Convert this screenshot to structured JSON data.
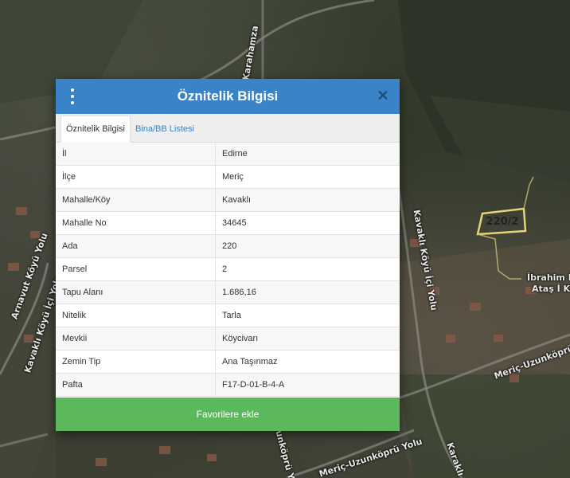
{
  "map": {
    "labels": {
      "karahamza": "Karahamza",
      "arnavut": "Arnavut Köyü Yolu",
      "kavakli_left": "Kavaklı Köyü İçi Yolu",
      "kavakli_mid": "Kavaklı Köyü İçi Yolu",
      "ibrahim": "İbrahim Hi",
      "atas": "Ataş İ K",
      "meric_uzunkopru_right": "Meriç-Uzunköprü",
      "meric_uzunkopru_bottom": "Meriç-Uzunköprü Yolu",
      "uzunkopru_yolu": "Uzunköprü Yolu",
      "karakli": "Karaklı"
    },
    "parcel_label": "220/2",
    "parcel_color": "#e6d37a"
  },
  "dialog": {
    "title": "Öznitelik Bilgisi",
    "close_symbol": "✕",
    "header_color": "#3a83c6",
    "tabs": [
      {
        "label": "Öznitelik Bilgisi",
        "active": true
      },
      {
        "label": "Bina/BB Listesi",
        "active": false
      }
    ],
    "rows": [
      {
        "key": "İl",
        "value": "Edirne"
      },
      {
        "key": "İlçe",
        "value": "Meriç"
      },
      {
        "key": "Mahalle/Köy",
        "value": "Kavaklı"
      },
      {
        "key": "Mahalle No",
        "value": "34645"
      },
      {
        "key": "Ada",
        "value": "220"
      },
      {
        "key": "Parsel",
        "value": "2"
      },
      {
        "key": "Tapu Alanı",
        "value": "1.686,16"
      },
      {
        "key": "Nitelik",
        "value": "Tarla"
      },
      {
        "key": "Mevkii",
        "value": "Köycivarı"
      },
      {
        "key": "Zemin Tip",
        "value": "Ana Taşınmaz"
      },
      {
        "key": "Pafta",
        "value": "F17-D-01-B-4-A"
      }
    ],
    "favorite_button": "Favorilere ekle",
    "favorite_color": "#5cb85c"
  }
}
